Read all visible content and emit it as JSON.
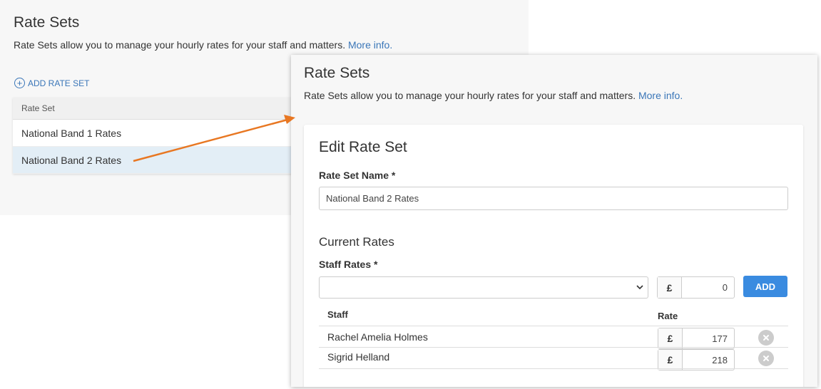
{
  "background": {
    "title": "Rate Sets",
    "description": "Rate Sets allow you to manage your hourly rates for your staff and matters.",
    "more_info": "More info.",
    "add_rate_set": "ADD RATE SET",
    "table_header": "Rate Set",
    "rows": [
      "National Band 1 Rates",
      "National Band 2 Rates"
    ],
    "selected_index": 1
  },
  "overlay": {
    "title": "Rate Sets",
    "description": "Rate Sets allow you to manage your hourly rates for your staff and matters.",
    "more_info": "More info.",
    "edit": {
      "title": "Edit Rate Set",
      "name_label": "Rate Set Name *",
      "name_value": "National Band 2 Rates",
      "current_rates": "Current Rates",
      "staff_rates_label": "Staff Rates *",
      "staff_select_value": "",
      "currency": "£",
      "new_rate_value": "0",
      "add_button": "ADD",
      "col_staff": "Staff",
      "col_rate": "Rate",
      "staff": [
        {
          "name": "Rachel Amelia Holmes",
          "rate": "177"
        },
        {
          "name": "Sigrid Helland",
          "rate": "218"
        }
      ]
    }
  },
  "colors": {
    "link": "#3a76b8",
    "accent": "#3a8be0",
    "arrow": "#e87722",
    "selected_row": "#e3eef6"
  }
}
